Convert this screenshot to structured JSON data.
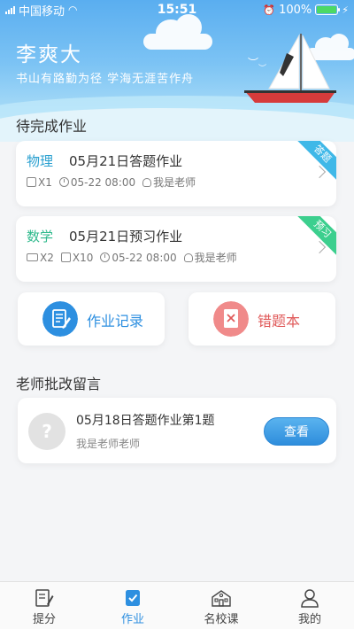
{
  "status_bar": {
    "carrier": "中国移动",
    "time": "15:51",
    "battery": "100%"
  },
  "header": {
    "name": "李爽大",
    "motto": "书山有路勤为径  学海无涯苦作舟"
  },
  "pending_section": {
    "title": "待完成作业",
    "items": [
      {
        "subject": "物理",
        "subject_color": "#2aa0d0",
        "title": "05月21日答题作业",
        "doc_count": "X1",
        "deadline": "05-22 08:00",
        "teacher": "我是老师",
        "badge": "答题",
        "badge_color": "#3fb8e8"
      },
      {
        "subject": "数学",
        "subject_color": "#2fb98c",
        "title": "05月21日预习作业",
        "video_count": "X2",
        "doc_count": "X10",
        "deadline": "05-22 08:00",
        "teacher": "我是老师",
        "badge": "预习",
        "badge_color": "#3ccf8e"
      }
    ]
  },
  "tools": {
    "homework_record": "作业记录",
    "wrong_book": "错题本"
  },
  "teacher_section": {
    "title": "老师批改留言",
    "message": {
      "title": "05月18日答题作业第1题",
      "from": "我是老师老师",
      "view_label": "查看"
    }
  },
  "tabbar": {
    "tabs": [
      {
        "label": "提分",
        "icon": "notebook-pen-icon"
      },
      {
        "label": "作业",
        "icon": "homework-check-icon"
      },
      {
        "label": "名校课",
        "icon": "school-building-icon"
      },
      {
        "label": "我的",
        "icon": "person-icon"
      }
    ],
    "active_index": 1
  },
  "colors": {
    "accent": "#2d8fe0",
    "wrong_book": "#e05a5a"
  }
}
